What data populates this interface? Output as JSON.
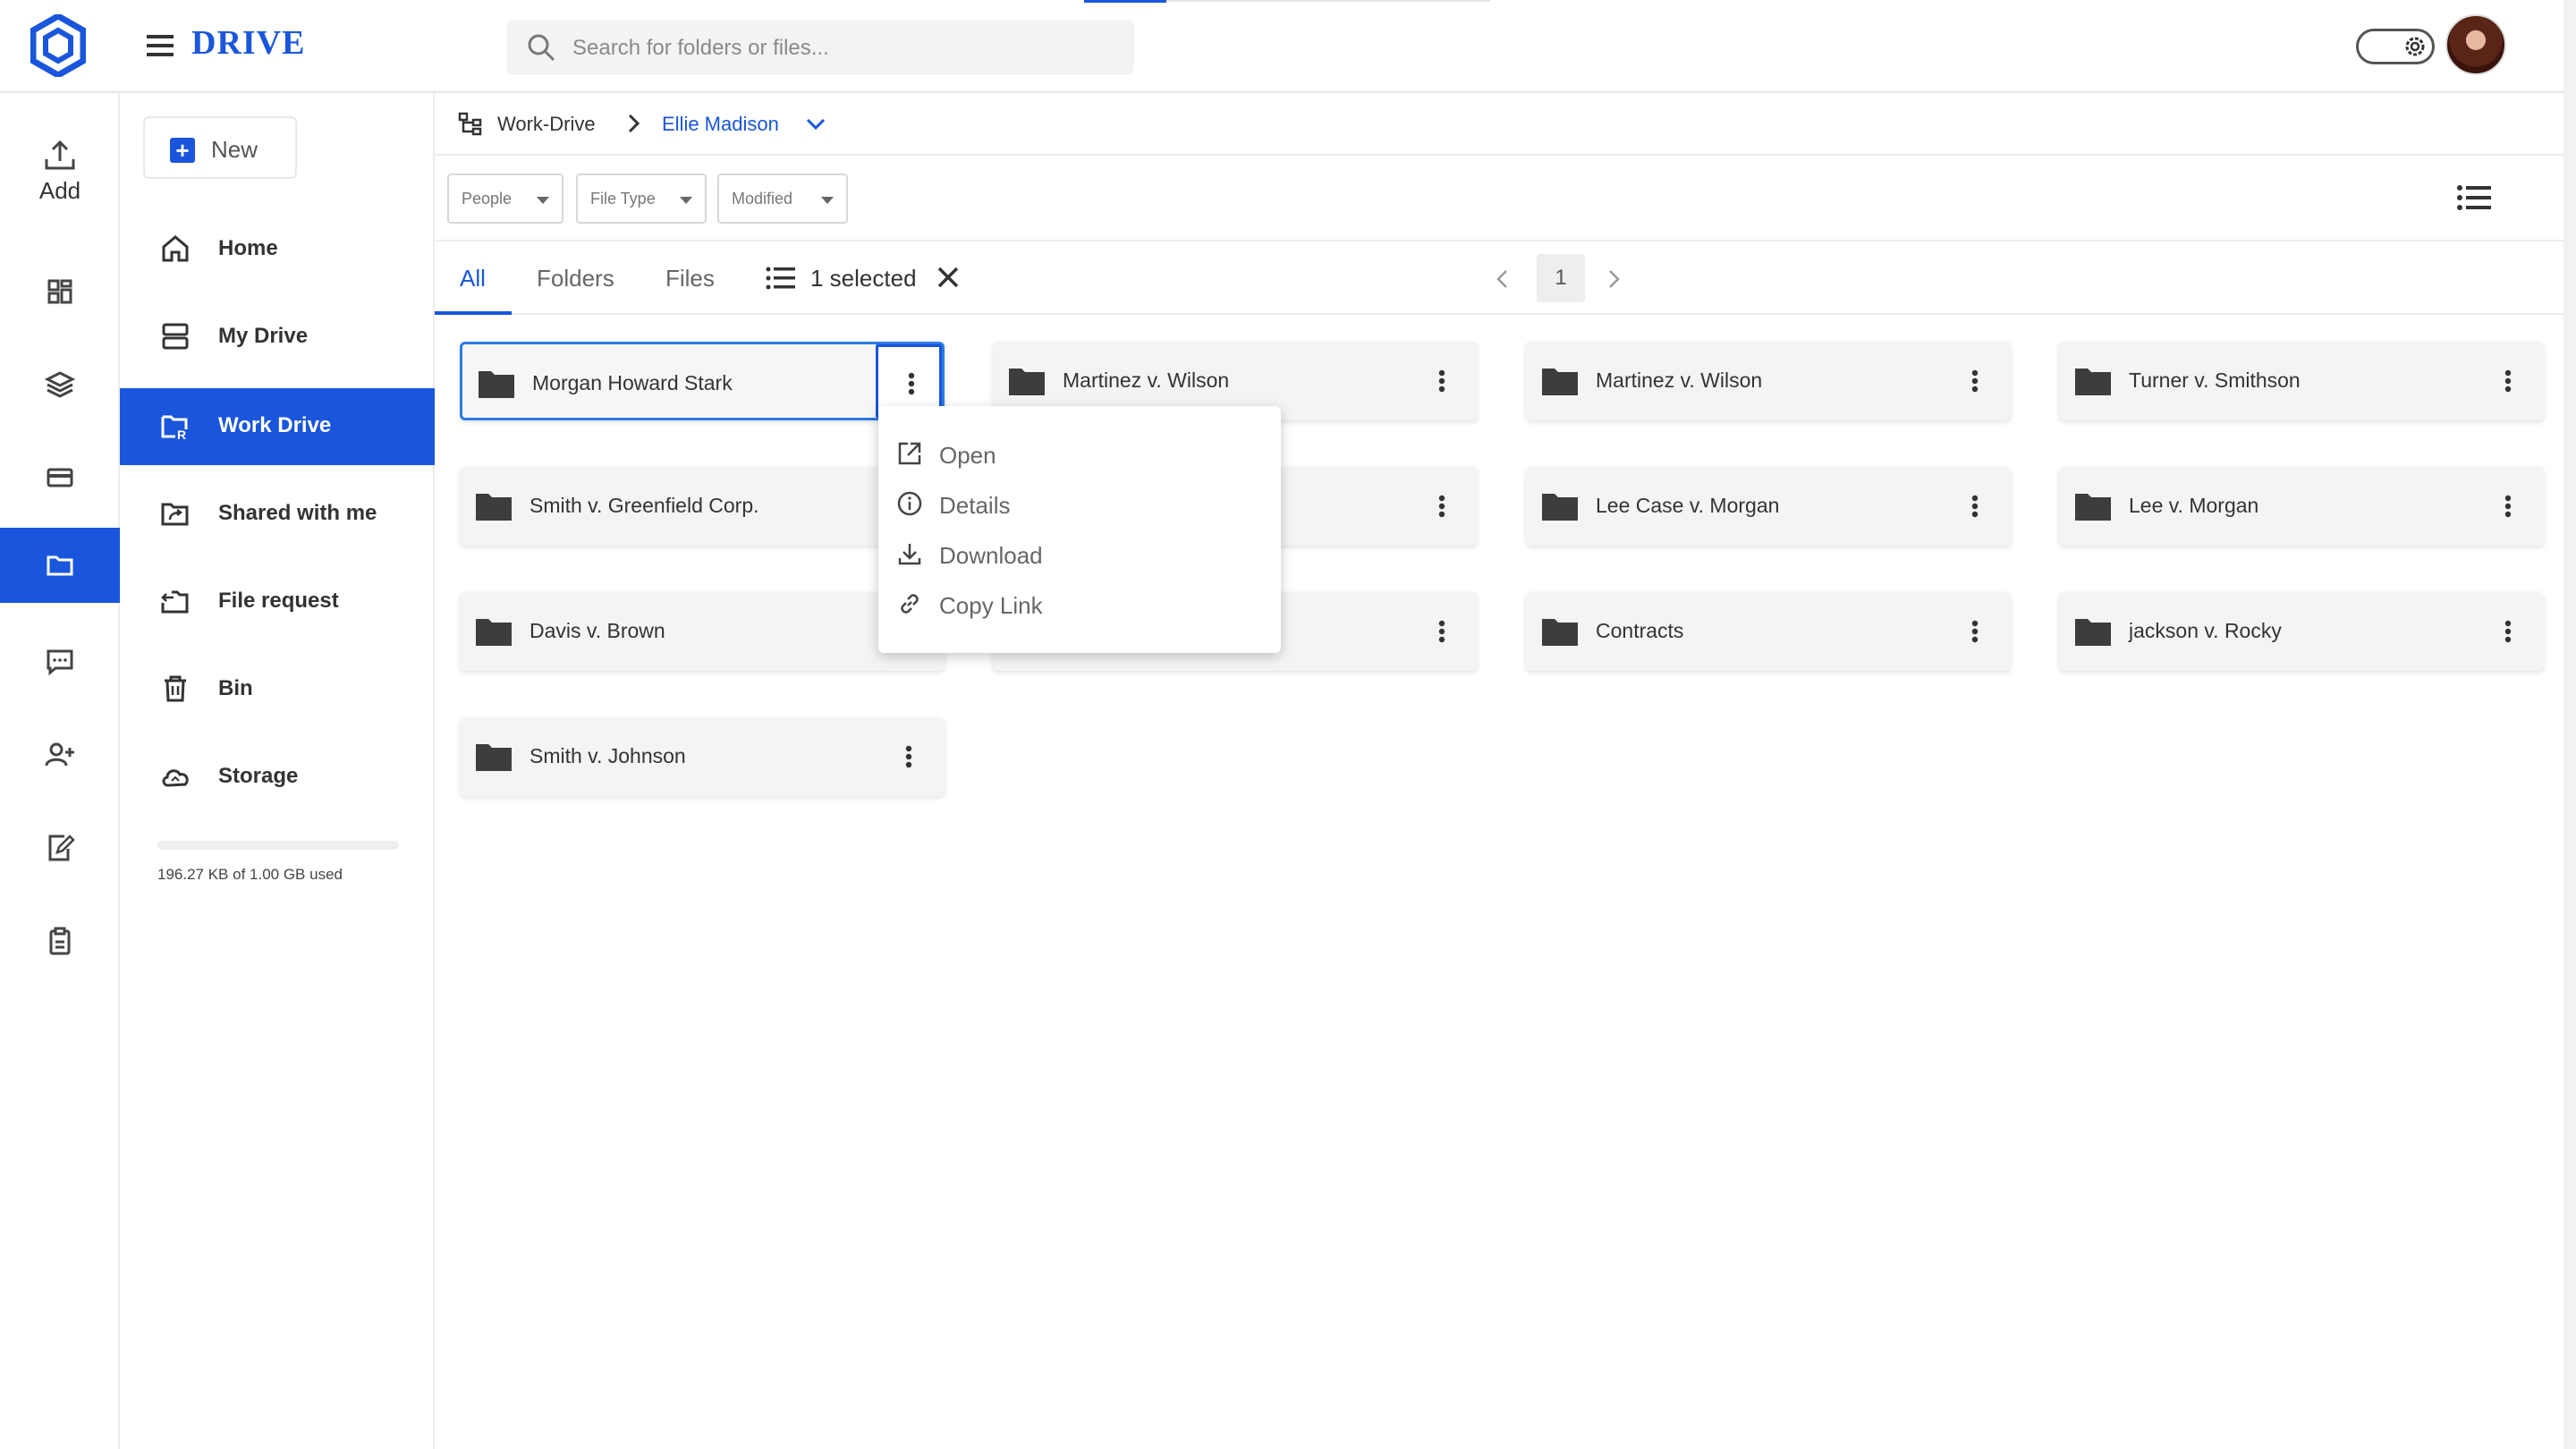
{
  "app": {
    "brand": "DRIVE"
  },
  "search": {
    "placeholder": "Search for folders or files..."
  },
  "rail": {
    "add_label": "Add"
  },
  "sidebar": {
    "new_label": "New",
    "items": [
      {
        "label": "Home",
        "icon": "home-icon"
      },
      {
        "label": "My Drive",
        "icon": "drive-icon"
      },
      {
        "label": "Work Drive",
        "icon": "work-drive-icon",
        "active": true
      },
      {
        "label": "Shared with me",
        "icon": "shared-folder-icon"
      },
      {
        "label": "File request",
        "icon": "file-request-icon"
      },
      {
        "label": "Bin",
        "icon": "trash-icon"
      },
      {
        "label": "Storage",
        "icon": "cloud-icon"
      }
    ],
    "storage_text": "196.27 KB of 1.00 GB used"
  },
  "breadcrumb": {
    "root": "Work-Drive",
    "current": "Ellie Madison"
  },
  "filters": [
    {
      "label": "People"
    },
    {
      "label": "File Type"
    },
    {
      "label": "Modified"
    }
  ],
  "tabs": [
    {
      "label": "All",
      "active": true
    },
    {
      "label": "Folders"
    },
    {
      "label": "Files"
    }
  ],
  "selection": {
    "text": "1 selected"
  },
  "pagination": {
    "page": "1"
  },
  "folders": [
    {
      "name": "Morgan Howard Stark",
      "selected": true
    },
    {
      "name": "Martinez v. Wilson"
    },
    {
      "name": "Martinez v. Wilson"
    },
    {
      "name": "Turner v. Smithson"
    },
    {
      "name": "Smith v. Greenfield Corp."
    },
    {
      "name": ""
    },
    {
      "name": "Lee Case v. Morgan"
    },
    {
      "name": "Lee v. Morgan"
    },
    {
      "name": "Davis v. Brown"
    },
    {
      "name": ""
    },
    {
      "name": "Contracts"
    },
    {
      "name": "jackson v. Rocky"
    },
    {
      "name": "Smith v. Johnson"
    }
  ],
  "context_menu": {
    "items": [
      {
        "label": "Open",
        "icon": "open-external-icon"
      },
      {
        "label": "Details",
        "icon": "info-icon"
      },
      {
        "label": "Download",
        "icon": "download-icon"
      },
      {
        "label": "Copy Link",
        "icon": "link-icon"
      }
    ]
  },
  "colors": {
    "accent": "#1a56db",
    "card_bg": "#f4f4f4",
    "folder": "#3d3d3d"
  }
}
